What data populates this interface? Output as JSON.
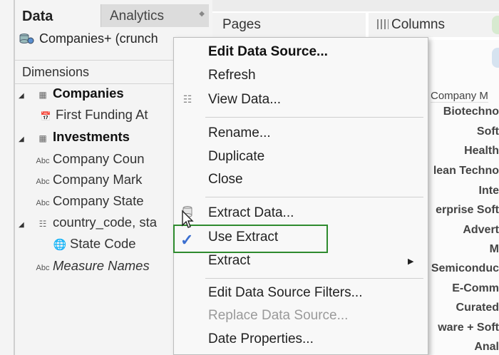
{
  "data_pane": {
    "tabs": [
      {
        "label": "Data"
      },
      {
        "label": "Analytics"
      }
    ],
    "data_source": "Companies+ (crunch",
    "dimensions_label": "Dimensions",
    "tree": [
      {
        "label": "Companies",
        "icon": "table-icon",
        "style": "bold"
      },
      {
        "label": "First Funding At",
        "icon": "calendar-icon",
        "style": "normal"
      },
      {
        "label": "Investments",
        "icon": "table-icon",
        "style": "bold"
      },
      {
        "label": "Company Coun",
        "icon": "Abc",
        "style": "normal"
      },
      {
        "label": "Company Mark",
        "icon": "Abc",
        "style": "normal"
      },
      {
        "label": "Company State",
        "icon": "Abc",
        "style": "normal"
      },
      {
        "label": "country_code, sta",
        "icon": "hierarchy-icon",
        "style": "normal"
      },
      {
        "label": "State Code",
        "icon": "globe-icon",
        "style": "normal"
      },
      {
        "label": "Measure Names",
        "icon": "Abc",
        "style": "italic"
      }
    ]
  },
  "shelves": {
    "pages_label": "Pages",
    "columns_label": "Columns"
  },
  "right_list": {
    "header": "Company M",
    "rows": [
      "Biotechno",
      "Soft",
      "Health",
      "lean Techno",
      "Inte",
      "erprise Soft",
      "Advert",
      "M",
      "Semiconduc",
      "E-Comm",
      "Curated",
      "ware + Soft",
      "Anal"
    ]
  },
  "context_menu": {
    "items": [
      {
        "label": "Edit Data Source...",
        "style": "bold"
      },
      {
        "label": "Refresh"
      },
      {
        "label": "View Data..."
      },
      {
        "label": "Rename..."
      },
      {
        "label": "Duplicate"
      },
      {
        "label": "Close"
      },
      {
        "label": "Extract Data..."
      },
      {
        "label": "Use Extract",
        "checked": true
      },
      {
        "label": "Extract",
        "submenu": true
      },
      {
        "label": "Edit Data Source Filters..."
      },
      {
        "label": "Replace Data Source...",
        "disabled": true
      },
      {
        "label": "Date Properties..."
      }
    ]
  },
  "colors": {
    "highlight_green": "#2e8b2e",
    "check_blue": "#3b6fd0"
  }
}
